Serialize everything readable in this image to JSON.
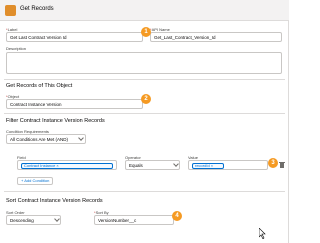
{
  "header": {
    "title": "Get Records"
  },
  "form": {
    "label": {
      "label": "Label",
      "value": "Get Last Contract Version Id"
    },
    "api_name": {
      "label": "API Name",
      "value": "Get_Last_Contract_Version_Id"
    },
    "description": {
      "label": "Description",
      "value": ""
    }
  },
  "object_section": {
    "title": "Get Records of This Object",
    "object_label": "Object",
    "object_value": "Contract Instance Version"
  },
  "filter_section": {
    "title": "Filter Contract Instance Version Records",
    "requirements_label": "Condition Requirements",
    "requirements_value": "All Conditions Are Met (AND)",
    "field_header": "Field",
    "operator_header": "Operator",
    "value_header": "Value",
    "row": {
      "field": "Contract Instance",
      "operator": "Equals",
      "value": "recordId"
    },
    "add_condition": "+ Add Condition"
  },
  "sort_section": {
    "title": "Sort Contract Instance Version Records",
    "order_label": "Sort Order",
    "order_value": "Descending",
    "by_label": "Sort By",
    "by_value": "VersionNumber__c"
  },
  "markers": [
    "1",
    "2",
    "3",
    "4"
  ],
  "colors": {
    "accent": "#f59a23",
    "link": "#0070d2",
    "header_bg": "#f3f2f2"
  },
  "icons": [
    "get-records-icon",
    "x-icon",
    "chevron-down-icon",
    "delete-icon",
    "mouse-cursor-icon"
  ]
}
